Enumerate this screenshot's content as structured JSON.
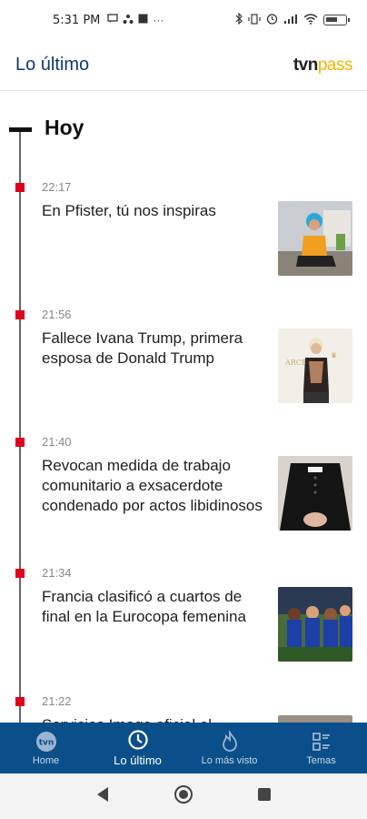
{
  "status_bar": {
    "time": "5:31 PM",
    "left_icons": [
      "message-icon",
      "share-icon",
      "square-icon",
      "more-dots-icon"
    ],
    "right_icons": [
      "bluetooth-icon",
      "vibrate-icon",
      "alarm-icon",
      "signal-icon",
      "wifi-icon",
      "battery-icon"
    ],
    "battery_level": 0.6
  },
  "header": {
    "title": "Lo último",
    "logo_tvn": "tvn",
    "logo_pass": "pass"
  },
  "section": {
    "title": "Hoy"
  },
  "news": [
    {
      "time": "22:17",
      "headline": "En Pfister, tú nos inspiras",
      "thumb": "woman-sitting-image"
    },
    {
      "time": "21:56",
      "headline": "Fallece Ivana Trump, primera esposa de Donald Trump",
      "thumb": "ivana-trump-image"
    },
    {
      "time": "21:40",
      "headline": "Revocan medida de trabajo comunitario a exsacerdote condenado por actos libidinosos",
      "thumb": "priest-collar-image"
    },
    {
      "time": "21:34",
      "headline": "Francia clasificó a cuartos de final en la Eurocopa femenina",
      "thumb": "france-team-image"
    },
    {
      "time": "21:22",
      "headline": "Servicios Image oficial el",
      "thumb": "partial-image"
    }
  ],
  "bottom_nav": [
    {
      "label": "Home",
      "icon": "tvn-circle-icon",
      "active": false
    },
    {
      "label": "Lo último",
      "icon": "clock-icon",
      "active": true
    },
    {
      "label": "Lo más visto",
      "icon": "flame-icon",
      "active": false
    },
    {
      "label": "Temas",
      "icon": "grid-list-icon",
      "active": false
    }
  ],
  "colors": {
    "primary": "#0a4f8a",
    "title_blue": "#0f3a6e",
    "accent_red": "#e0001b",
    "logo_yellow": "#f2b400"
  }
}
